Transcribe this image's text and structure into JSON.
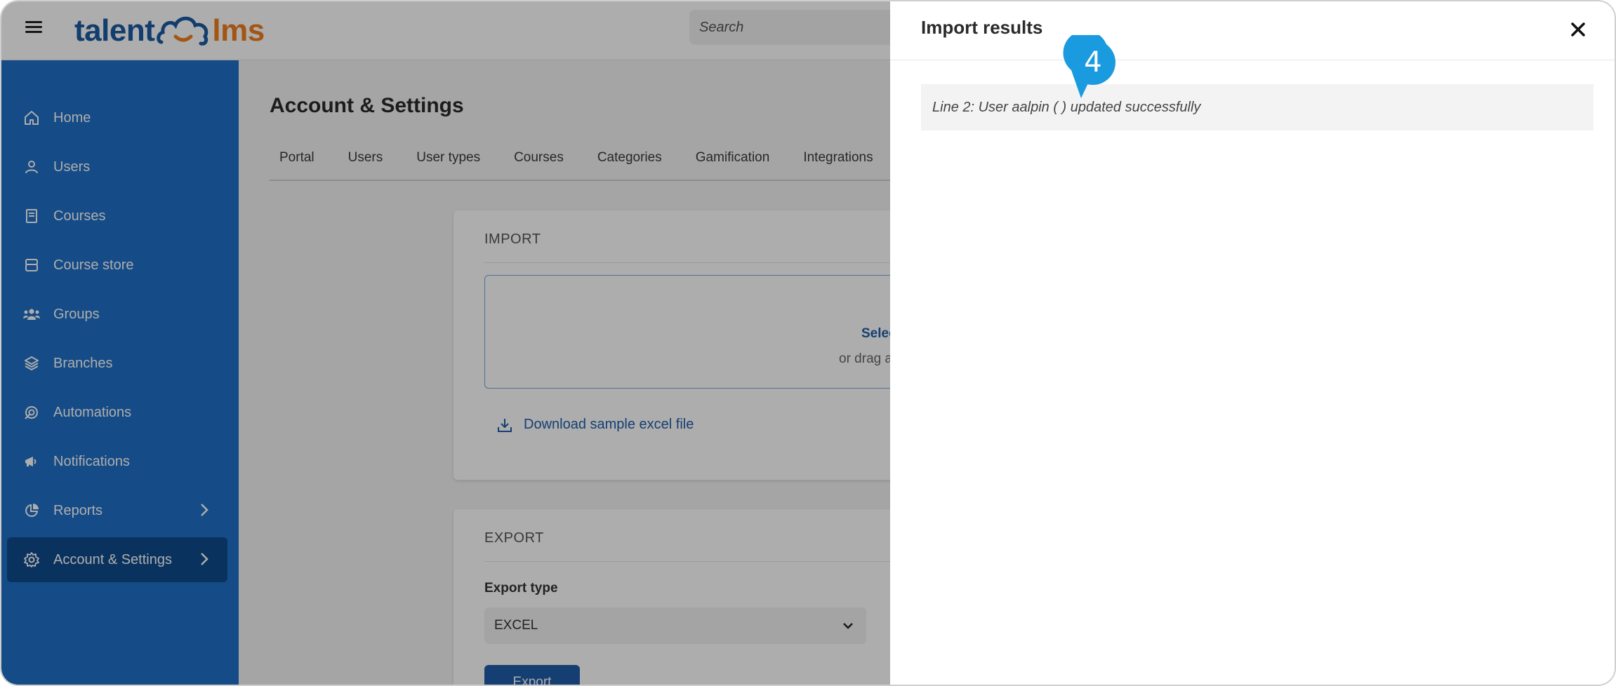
{
  "app": {
    "logo_left": "talent",
    "logo_right": "lms",
    "search_placeholder": "Search"
  },
  "sidebar": {
    "items": [
      {
        "label": "Home",
        "icon": "home-icon"
      },
      {
        "label": "Users",
        "icon": "user-icon"
      },
      {
        "label": "Courses",
        "icon": "book-icon"
      },
      {
        "label": "Course store",
        "icon": "store-icon"
      },
      {
        "label": "Groups",
        "icon": "group-icon"
      },
      {
        "label": "Branches",
        "icon": "layers-icon"
      },
      {
        "label": "Automations",
        "icon": "automation-icon"
      },
      {
        "label": "Notifications",
        "icon": "megaphone-icon"
      },
      {
        "label": "Reports",
        "icon": "pie-chart-icon"
      },
      {
        "label": "Account & Settings",
        "icon": "gear-icon",
        "active": true
      }
    ]
  },
  "main": {
    "title": "Account & Settings",
    "tabs": [
      "Portal",
      "Users",
      "User types",
      "Courses",
      "Categories",
      "Gamification",
      "Integrations"
    ],
    "import_card": {
      "title": "IMPORT",
      "select_text": "Selec",
      "drag_text": "or drag a",
      "download_label": "Download sample excel file"
    },
    "export_card": {
      "title": "EXPORT",
      "type_label": "Export type",
      "type_value": "EXCEL",
      "button_label": "Export"
    }
  },
  "drawer": {
    "title": "Import results",
    "results": [
      "Line 2: User aalpin ( ) updated successfully"
    ]
  },
  "annotation": {
    "number": "4",
    "color": "#1a9be0"
  },
  "colors": {
    "sidebar": "#1f6fc6",
    "sidebar_active": "#0f4a8c",
    "brand_blue": "#1b5aa1",
    "brand_orange": "#f07f1e",
    "link": "#1f5ea8"
  }
}
